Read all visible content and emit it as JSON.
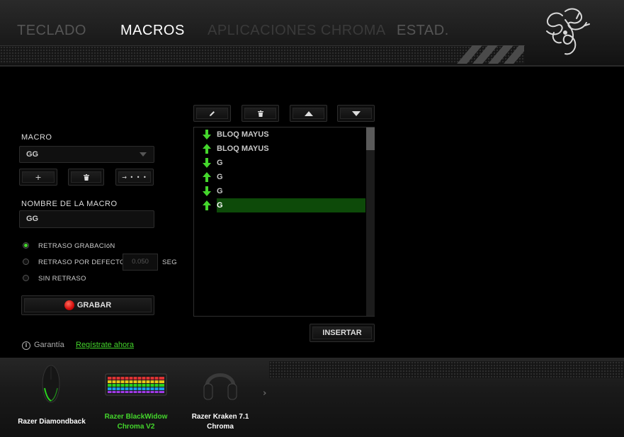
{
  "header": {
    "tabs": [
      {
        "label": "TECLADO",
        "state": "inactive"
      },
      {
        "label": "MACROS",
        "state": "active"
      },
      {
        "label": "APLICACIONES CHROMA",
        "state": "dim"
      },
      {
        "label": "ESTAD.",
        "state": "inactive"
      }
    ],
    "logo_icon": "razer-snake-logo-icon"
  },
  "left": {
    "macro_label": "MACRO",
    "macro_selected": "GG",
    "add_button": "+",
    "delete_icon": "trash-icon",
    "more_button": "→ • • •",
    "name_label": "NOMBRE DE LA MACRO",
    "name_value": "GG",
    "delay_options": [
      {
        "label": "RETRASO GRABACIóN",
        "selected": true
      },
      {
        "label": "RETRASO POR DEFECTO",
        "selected": false
      },
      {
        "label": "SIN RETRASO",
        "selected": false
      }
    ],
    "default_delay_placeholder": "0.050",
    "delay_unit": "SEG",
    "record_label": "GRABAR"
  },
  "list": {
    "toolbar_icons": [
      "pencil-icon",
      "trash-icon",
      "arrow-up-icon",
      "arrow-down-icon"
    ],
    "items": [
      {
        "dir": "down",
        "text": "BLOQ MAYUS",
        "selected": false
      },
      {
        "dir": "up",
        "text": "BLOQ MAYUS",
        "selected": false
      },
      {
        "dir": "down",
        "text": "G",
        "selected": false
      },
      {
        "dir": "up",
        "text": "G",
        "selected": false
      },
      {
        "dir": "down",
        "text": "G",
        "selected": false
      },
      {
        "dir": "up",
        "text": "G",
        "selected": true
      }
    ],
    "insert_label": "INSERTAR"
  },
  "footer": {
    "warranty_label": "Garantía",
    "register_link": "Regístrate ahora"
  },
  "devices": [
    {
      "name_line1": "Razer Diamondback",
      "name_line2": "",
      "icon": "mouse-icon",
      "active": false
    },
    {
      "name_line1": "Razer BlackWidow",
      "name_line2": "Chroma V2",
      "icon": "keyboard-icon",
      "active": true
    },
    {
      "name_line1": "Razer Kraken 7.1",
      "name_line2": "Chroma",
      "icon": "headset-icon",
      "active": false
    }
  ],
  "next_devices_icon": "chevron-right-icon",
  "colors": {
    "accent": "#44d62c",
    "selected_row": "#0d4a09",
    "record": "#d10b0b"
  }
}
